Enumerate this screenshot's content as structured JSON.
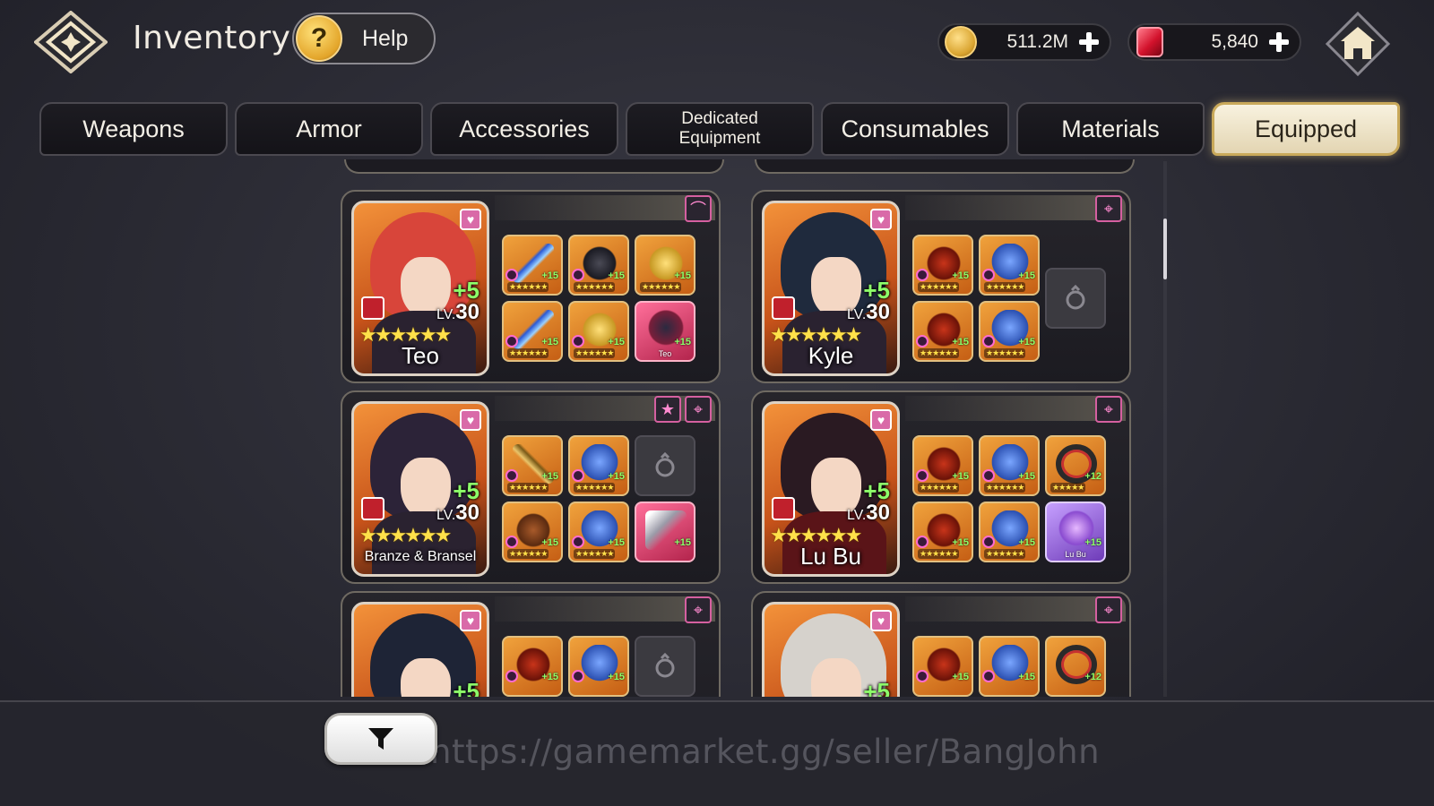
{
  "header": {
    "title": "Inventory",
    "help_label": "Help",
    "gold": "511.2M",
    "gems": "5,840"
  },
  "tabs": [
    {
      "label": "Weapons",
      "active": false
    },
    {
      "label": "Armor",
      "active": false
    },
    {
      "label": "Accessories",
      "active": false
    },
    {
      "label": "Dedicated Equipment",
      "active": false
    },
    {
      "label": "Consumables",
      "active": false
    },
    {
      "label": "Materials",
      "active": false
    },
    {
      "label": "Equipped",
      "active": true
    }
  ],
  "heroes": [
    {
      "name": "Teo",
      "plus": "+5",
      "level": "30",
      "stars": "★★★★★★",
      "items": [
        {
          "art": "blade",
          "plus": "+15",
          "stars": "★★★★★★"
        },
        {
          "art": "dark",
          "plus": "+15",
          "stars": "★★★★★★"
        },
        {
          "art": "gold",
          "plus": "+15",
          "stars": "★★★★★★"
        },
        {
          "art": "blade",
          "plus": "+15",
          "stars": "★★★★★★"
        },
        {
          "art": "gold",
          "plus": "+15",
          "stars": "★★★★★★"
        },
        {
          "art": "bird",
          "plus": "+15",
          "owner": "Teo",
          "rarity": "pink"
        }
      ]
    },
    {
      "name": "Kyle",
      "plus": "+5",
      "level": "30",
      "stars": "★★★★★★",
      "items": [
        {
          "art": "dragon",
          "plus": "+15",
          "stars": "★★★★★★"
        },
        {
          "art": "armor",
          "plus": "+15",
          "stars": "★★★★★★"
        },
        {
          "art": "dragon",
          "plus": "+15",
          "stars": "★★★★★★"
        },
        {
          "art": "armor",
          "plus": "+15",
          "stars": "★★★★★★"
        }
      ]
    },
    {
      "name": "Branze & Bransel",
      "plus": "+5",
      "level": "30",
      "stars": "★★★★★★",
      "items": [
        {
          "art": "bow",
          "plus": "+15",
          "stars": "★★★★★★"
        },
        {
          "art": "armor",
          "plus": "+15",
          "stars": "★★★★★★"
        },
        {
          "art": "crest",
          "plus": "+15",
          "stars": "★★★★★★"
        },
        {
          "art": "armor",
          "plus": "+15",
          "stars": "★★★★★★"
        },
        {
          "art": "wing",
          "plus": "+15",
          "rarity": "pink"
        }
      ]
    },
    {
      "name": "Lu Bu",
      "plus": "+5",
      "level": "30",
      "stars": "★★★★★★",
      "items": [
        {
          "art": "dragon",
          "plus": "+15",
          "stars": "★★★★★★"
        },
        {
          "art": "armor",
          "plus": "+15",
          "stars": "★★★★★★"
        },
        {
          "art": "ring",
          "plus": "+12",
          "stars": "★★★★★"
        },
        {
          "art": "dragon",
          "plus": "+15",
          "stars": "★★★★★★"
        },
        {
          "art": "armor",
          "plus": "+15",
          "stars": "★★★★★★"
        },
        {
          "art": "gem",
          "plus": "+15",
          "owner": "Lu Bu",
          "rarity": "purple"
        }
      ]
    },
    {
      "plus": "+5",
      "items": [
        {
          "art": "dragon",
          "plus": "+15"
        },
        {
          "art": "armor",
          "plus": "+15"
        }
      ]
    },
    {
      "plus": "+5",
      "items": [
        {
          "art": "dragon",
          "plus": "+15"
        },
        {
          "art": "armor",
          "plus": "+15"
        },
        {
          "art": "ring",
          "plus": "+12"
        }
      ]
    }
  ],
  "watermark": "https://gamemarket.gg/seller/BangJohn",
  "colors": {
    "accent_gold": "#c9a95a",
    "tab_active_bg": "#f3ead0",
    "plus_green": "#8dff6a",
    "star_yellow": "#ffe14a"
  },
  "icons": {
    "logo": "diamond-star-logo-icon",
    "help": "question-mark-icon",
    "gold": "gold-coin-icon",
    "gem": "red-gem-icon",
    "home": "home-icon",
    "filter": "funnel-filter-icon",
    "favorite": "heart-badge-icon",
    "crosshair": "crosshair-tag-icon",
    "bow": "bow-tag-icon",
    "star": "star-tag-icon",
    "empty_slot": "ring-slot-icon"
  }
}
